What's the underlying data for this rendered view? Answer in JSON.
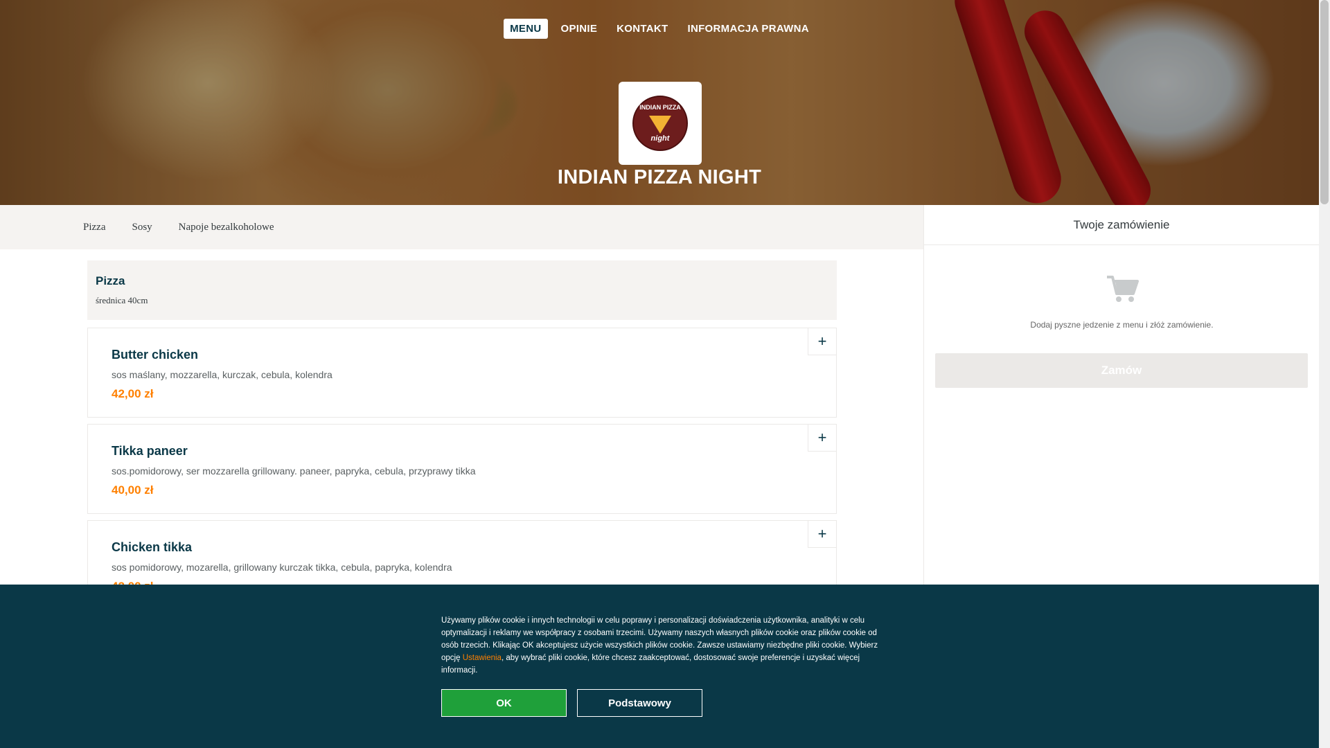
{
  "header": {
    "nav": [
      {
        "label": "MENU",
        "active": true
      },
      {
        "label": "OPINIE"
      },
      {
        "label": "KONTAKT"
      },
      {
        "label": "INFORMACJA PRAWNA"
      }
    ],
    "logo_text_top": "INDIAN PIZZA",
    "logo_text_bottom": "night",
    "restaurant_name": "INDIAN PIZZA NIGHT"
  },
  "categories": [
    "Pizza",
    "Sosy",
    "Napoje bezalkoholowe"
  ],
  "menu": {
    "section_title": "Pizza",
    "section_subtitle": "średnica 40cm",
    "items": [
      {
        "name": "Butter chicken",
        "description": "sos maślany, mozzarella, kurczak, cebula, kolendra",
        "price": "42,00 zł"
      },
      {
        "name": "Tikka paneer",
        "description": "sos.pomidorowy, ser mozzarella grillowany. paneer, papryka, cebula, przyprawy tikka",
        "price": "40,00 zł"
      },
      {
        "name": "Chicken tikka",
        "description": "sos pomidorowy, mozarella, grillowany kurczak tikka, cebula, papryka, kolendra",
        "price": "42,00 zł"
      }
    ],
    "add_label": "+"
  },
  "basket": {
    "title": "Twoje zamówienie",
    "empty_text": "Dodaj pyszne jedzenie z menu i złóż zamówienie.",
    "order_button": "Zamów",
    "icon": "cart-icon"
  },
  "cookie": {
    "text_before": "Używamy plików cookie i innych technologii w celu poprawy i personalizacji doświadczenia użytkownika, analityki w celu optymalizacji i reklamy we współpracy z osobami trzecimi. Używamy naszych własnych plików cookie oraz plików cookie od osób trzecich. Klikając OK akceptujesz użycie wszystkich plików cookie. Zawsze ustawiamy niezbędne pliki cookie. Wybierz opcję ",
    "link": "Ustawienia",
    "text_after": ", aby wybrać pliki cookie, które chcesz zaakceptować, dostosować swoje preferencje i uzyskać więcej informacji.",
    "ok_button": "OK",
    "basic_button": "Podstawowy"
  },
  "colors": {
    "brand_dark": "#0a3847",
    "price_orange": "#ff8000",
    "ok_green": "#1fa03a",
    "panel_bg": "#f5f3f1"
  }
}
